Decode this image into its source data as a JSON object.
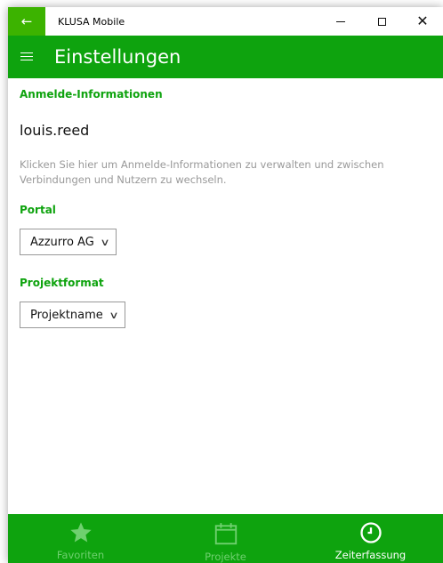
{
  "window": {
    "title": "KLUSA Mobile",
    "back_icon": "arrow-left-icon",
    "close_glyph": "✕"
  },
  "header": {
    "menu_icon": "hamburger-icon",
    "title": "Einstellungen"
  },
  "credentials": {
    "heading": "Anmelde-Informationen",
    "username": "louis.reed",
    "hint": "Klicken Sie hier um Anmelde-Informationen zu verwalten und zwischen Verbindungen und Nutzern zu wechseln."
  },
  "portal": {
    "heading": "Portal",
    "selected": "Azzurro AG"
  },
  "project_format": {
    "heading": "Projektformat",
    "selected": "Projektname"
  },
  "bottom_nav": {
    "items": [
      {
        "label": "Favoriten",
        "icon": "star-icon",
        "active": false
      },
      {
        "label": "Projekte",
        "icon": "calendar-icon",
        "active": false
      },
      {
        "label": "Zeiterfassung",
        "icon": "clock-icon",
        "active": true
      }
    ]
  },
  "colors": {
    "brand_green": "#0ea30e",
    "back_button_green": "#3cb300",
    "hint_gray": "#999999",
    "inactive_nav": "#6fd06f"
  }
}
